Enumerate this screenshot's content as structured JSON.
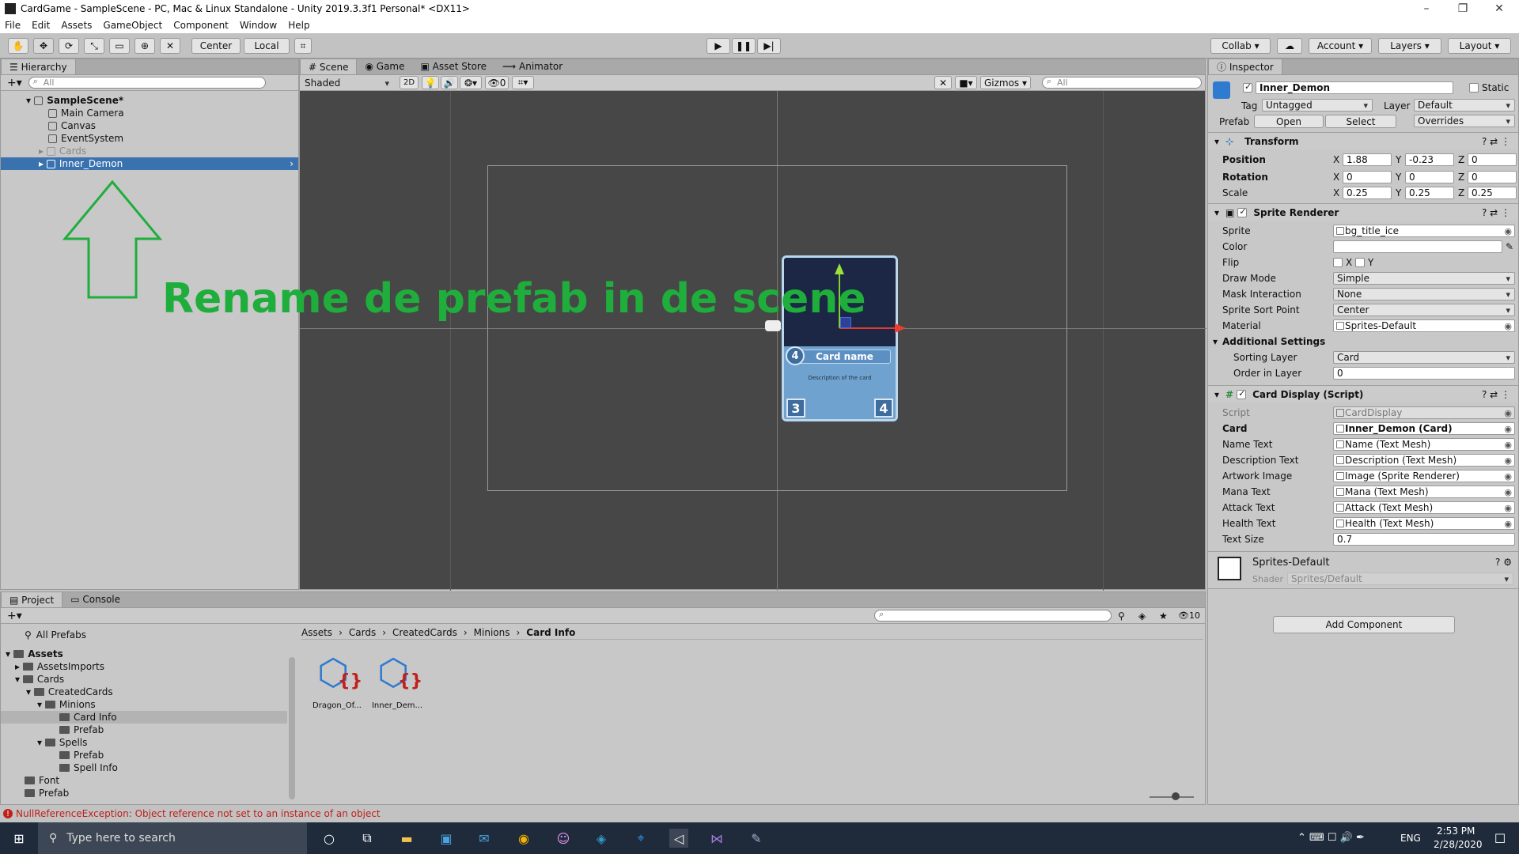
{
  "window": {
    "title": "CardGame - SampleScene - PC, Mac & Linux Standalone - Unity 2019.3.3f1 Personal* <DX11>",
    "minimize": "–",
    "maximize": "❐",
    "close": "✕"
  },
  "menu": [
    "File",
    "Edit",
    "Assets",
    "GameObject",
    "Component",
    "Window",
    "Help"
  ],
  "toolbar": {
    "center": "Center",
    "local": "Local",
    "collab": "Collab",
    "account": "Account",
    "layers": "Layers",
    "layout": "Layout"
  },
  "hierarchy": {
    "tab": "Hierarchy",
    "search_placeholder": "All",
    "scene": "SampleScene*",
    "items": [
      "Main Camera",
      "Canvas",
      "EventSystem",
      "Cards",
      "Inner_Demon"
    ],
    "annotation": "Rename de prefab in de scene"
  },
  "scene": {
    "tabs": [
      "Scene",
      "Game",
      "Asset Store",
      "Animator"
    ],
    "shading": "Shaded",
    "mode2d": "2D",
    "hidden_count": "0",
    "gizmos": "Gizmos",
    "search_placeholder": "All"
  },
  "card": {
    "mana": "4",
    "name": "Card name",
    "description": "Description of the card",
    "attack": "3",
    "health": "4"
  },
  "inspector": {
    "tab": "Inspector",
    "object_name": "Inner_Demon",
    "static_label": "Static",
    "tag_label": "Tag",
    "tag_value": "Untagged",
    "layer_label": "Layer",
    "layer_value": "Default",
    "prefab_label": "Prefab",
    "prefab_open": "Open",
    "prefab_select": "Select",
    "prefab_overrides": "Overrides",
    "transform": {
      "title": "Transform",
      "position_label": "Position",
      "rotation_label": "Rotation",
      "scale_label": "Scale",
      "position": {
        "x": "1.88",
        "y": "-0.23",
        "z": "0"
      },
      "rotation": {
        "x": "0",
        "y": "0",
        "z": "0"
      },
      "scale": {
        "x": "0.25",
        "y": "0.25",
        "z": "0.25"
      },
      "x": "X",
      "y": "Y",
      "z": "Z"
    },
    "sprite_renderer": {
      "title": "Sprite Renderer",
      "sprite_label": "Sprite",
      "sprite": "bg_title_ice",
      "color_label": "Color",
      "flip_label": "Flip",
      "flip_x": "X",
      "flip_y": "Y",
      "draw_mode_label": "Draw Mode",
      "draw_mode": "Simple",
      "mask_label": "Mask Interaction",
      "mask": "None",
      "sort_point_label": "Sprite Sort Point",
      "sort_point": "Center",
      "material_label": "Material",
      "material": "Sprites-Default",
      "additional": "Additional Settings",
      "sorting_layer_label": "Sorting Layer",
      "sorting_layer": "Card",
      "order_label": "Order in Layer",
      "order": "0"
    },
    "card_display": {
      "title": "Card Display (Script)",
      "script_label": "Script",
      "script": "CardDisplay",
      "card_label": "Card",
      "card": "Inner_Demon (Card)",
      "name_text_label": "Name Text",
      "name_text": "Name (Text Mesh)",
      "desc_label": "Description Text",
      "desc": "Description (Text Mesh)",
      "artwork_label": "Artwork Image",
      "artwork": "Image (Sprite Renderer)",
      "mana_label": "Mana Text",
      "mana": "Mana (Text Mesh)",
      "attack_label": "Attack Text",
      "attack": "Attack (Text Mesh)",
      "health_label": "Health Text",
      "health": "Health (Text Mesh)",
      "textsize_label": "Text Size",
      "textsize": "0.7"
    },
    "material": {
      "name": "Sprites-Default",
      "shader_label": "Shader",
      "shader": "Sprites/Default"
    },
    "add_component": "Add Component"
  },
  "project": {
    "tabs": [
      "Project",
      "Console"
    ],
    "hidden_count": "10",
    "all_prefabs": "All Prefabs",
    "tree": [
      "Assets",
      "AssetsImports",
      "Cards",
      "CreatedCards",
      "Minions",
      "Card Info",
      "Prefab",
      "Spells",
      "Prefab",
      "Spell Info",
      "Font",
      "Prefab"
    ],
    "breadcrumb": [
      "Assets",
      "Cards",
      "CreatedCards",
      "Minions",
      "Card Info"
    ],
    "assets": [
      "Dragon_Of...",
      "Inner_Dem..."
    ]
  },
  "status": {
    "error": "NullReferenceException: Object reference not set to an instance of an object"
  },
  "taskbar": {
    "search_placeholder": "Type here to search",
    "lang": "ENG",
    "time": "2:53 PM",
    "date": "2/28/2020"
  },
  "colors": {
    "selection": "#3a72b0",
    "annotation": "#1fae3c",
    "scene_bg": "#474747"
  }
}
